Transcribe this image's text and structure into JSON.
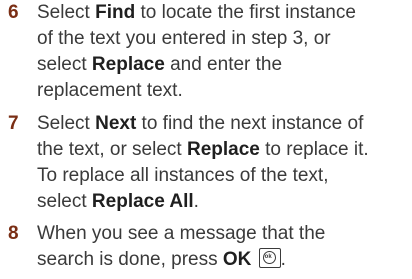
{
  "steps": [
    {
      "number": "6",
      "lines": [
        [
          {
            "t": "Select "
          },
          {
            "t": "Find",
            "b": true
          },
          {
            "t": " to locate the first instance"
          }
        ],
        [
          {
            "t": "of the text you entered in step 3, or"
          }
        ],
        [
          {
            "t": "select "
          },
          {
            "t": "Replace",
            "b": true
          },
          {
            "t": " and enter the"
          }
        ],
        [
          {
            "t": "replacement text."
          }
        ]
      ]
    },
    {
      "number": "7",
      "lines": [
        [
          {
            "t": "Select "
          },
          {
            "t": "Next",
            "b": true
          },
          {
            "t": " to find the next instance of"
          }
        ],
        [
          {
            "t": "the text, or select "
          },
          {
            "t": "Replace",
            "b": true
          },
          {
            "t": " to replace it."
          }
        ],
        [
          {
            "t": "To replace all instances of the text,"
          }
        ],
        [
          {
            "t": "select "
          },
          {
            "t": "Replace All",
            "b": true
          },
          {
            "t": "."
          }
        ]
      ]
    },
    {
      "number": "8",
      "lines": [
        [
          {
            "t": "When you see a message that the"
          }
        ],
        [
          {
            "t": "search is done, press "
          },
          {
            "t": "OK",
            "b": true
          },
          {
            "t": " "
          },
          {
            "icon": "ok-key-icon",
            "label": "ok"
          },
          {
            "t": "."
          }
        ]
      ]
    }
  ]
}
